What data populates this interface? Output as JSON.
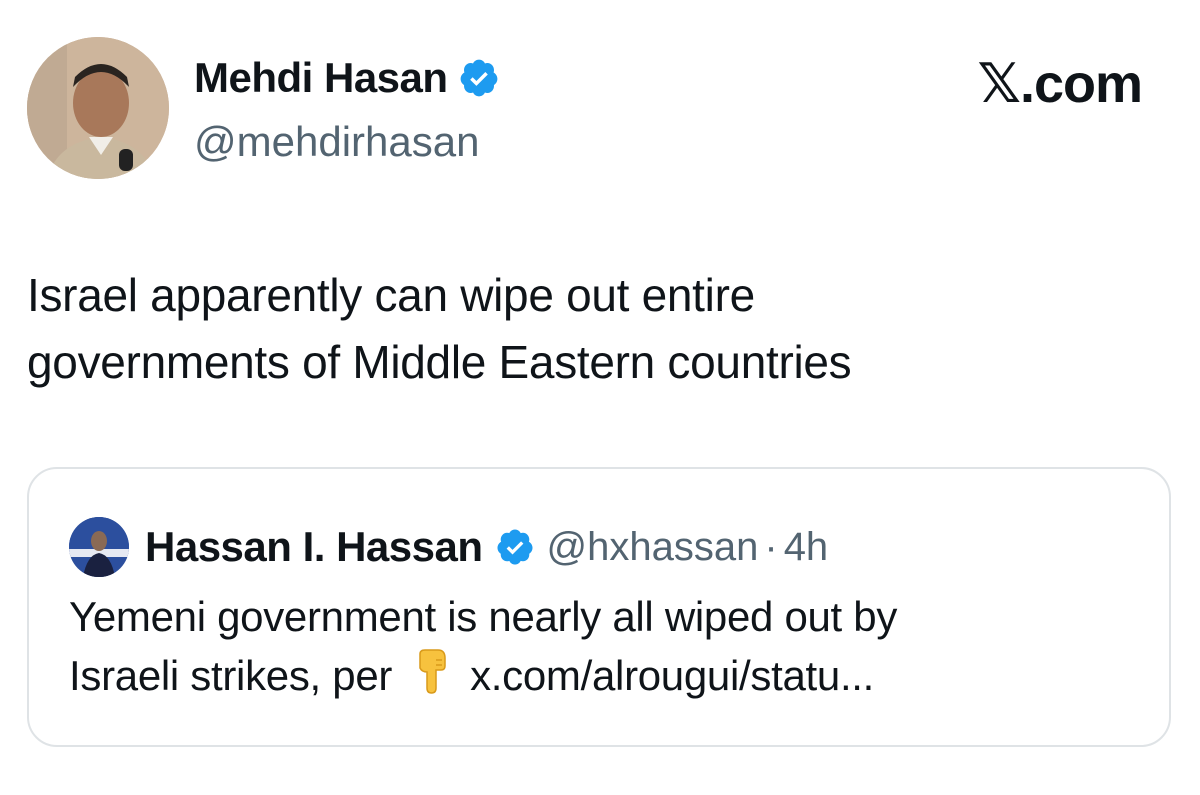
{
  "author": {
    "name": "Mehdi Hasan",
    "handle": "@mehdirhasan",
    "verified_icon": "verified-badge-icon",
    "avatar_icon": "avatar"
  },
  "brand": {
    "label": "𝕏.com"
  },
  "tweet": {
    "line1": "Israel apparently can wipe out entire",
    "line2": "governments of Middle Eastern countries"
  },
  "quote": {
    "name": "Hassan I. Hassan",
    "handle": "@hxhassan",
    "separator": "·",
    "time": "4h",
    "line1": "Yemeni government is nearly all wiped out by",
    "line2_prefix": "Israeli strikes, per",
    "link": "x.com/alrougui/statu...",
    "pointer_icon": "backhand-index-pointing-down-icon"
  },
  "colors": {
    "text": "#0f1419",
    "secondary": "#536471",
    "verified": "#1d9bf0",
    "border": "#dfe3e6"
  }
}
